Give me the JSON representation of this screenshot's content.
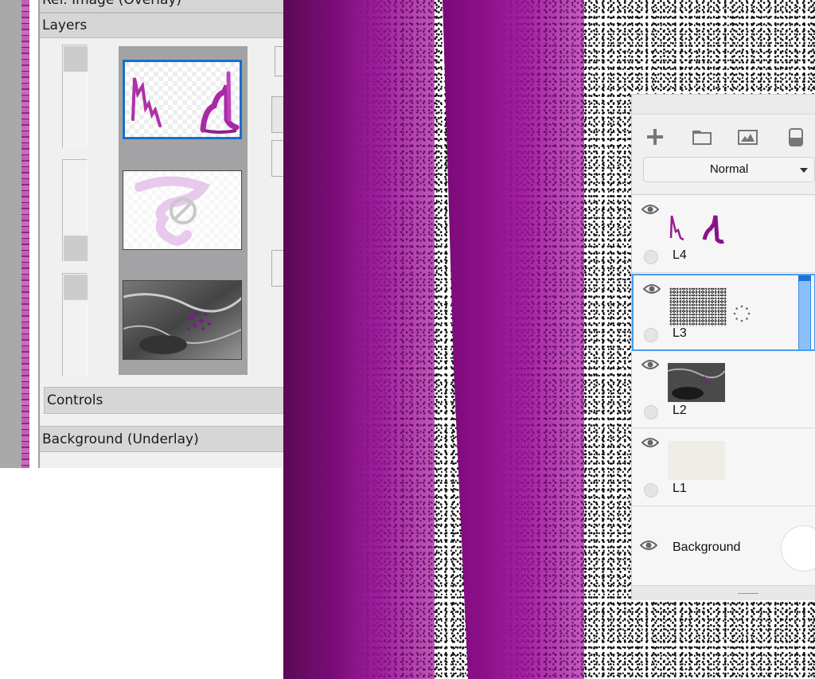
{
  "left_panel": {
    "sections": {
      "ref_image": "Ref. Image (Overlay)",
      "layers": "Layers",
      "controls": "Controls",
      "background": "Background (Underlay)"
    },
    "layers": [
      {
        "id": "top",
        "selected": true,
        "opacity_fraction": 1.0,
        "hidden": false,
        "thumb": "magenta-strokes"
      },
      {
        "id": "middle",
        "selected": false,
        "opacity_fraction": 0.0,
        "hidden": true,
        "thumb": "pink-faded-strokes",
        "status_icon": "prohibited-icon"
      },
      {
        "id": "bottom",
        "selected": false,
        "opacity_fraction": 1.0,
        "hidden": false,
        "thumb": "grayscale-texture"
      }
    ]
  },
  "layers_panel": {
    "toolbar": {
      "icons": [
        "plus-icon",
        "folder-icon",
        "image-icon",
        "eraser-icon"
      ]
    },
    "blend_mode": "Normal",
    "layers": [
      {
        "name": "L4",
        "visible": true,
        "active": false,
        "thumb": "magenta-strokes"
      },
      {
        "name": "L3",
        "visible": true,
        "active": true,
        "thumb": "noise",
        "loading": true,
        "opacity_percent": 100
      },
      {
        "name": "L2",
        "visible": true,
        "active": false,
        "thumb": "grayscale-texture"
      },
      {
        "name": "L1",
        "visible": true,
        "active": false,
        "thumb": "paper"
      }
    ],
    "background": {
      "label": "Background",
      "visible": true,
      "color": "#ffffff"
    }
  },
  "canvas": {
    "stroke_color": "#a020a0",
    "noise_color": "#111111"
  }
}
